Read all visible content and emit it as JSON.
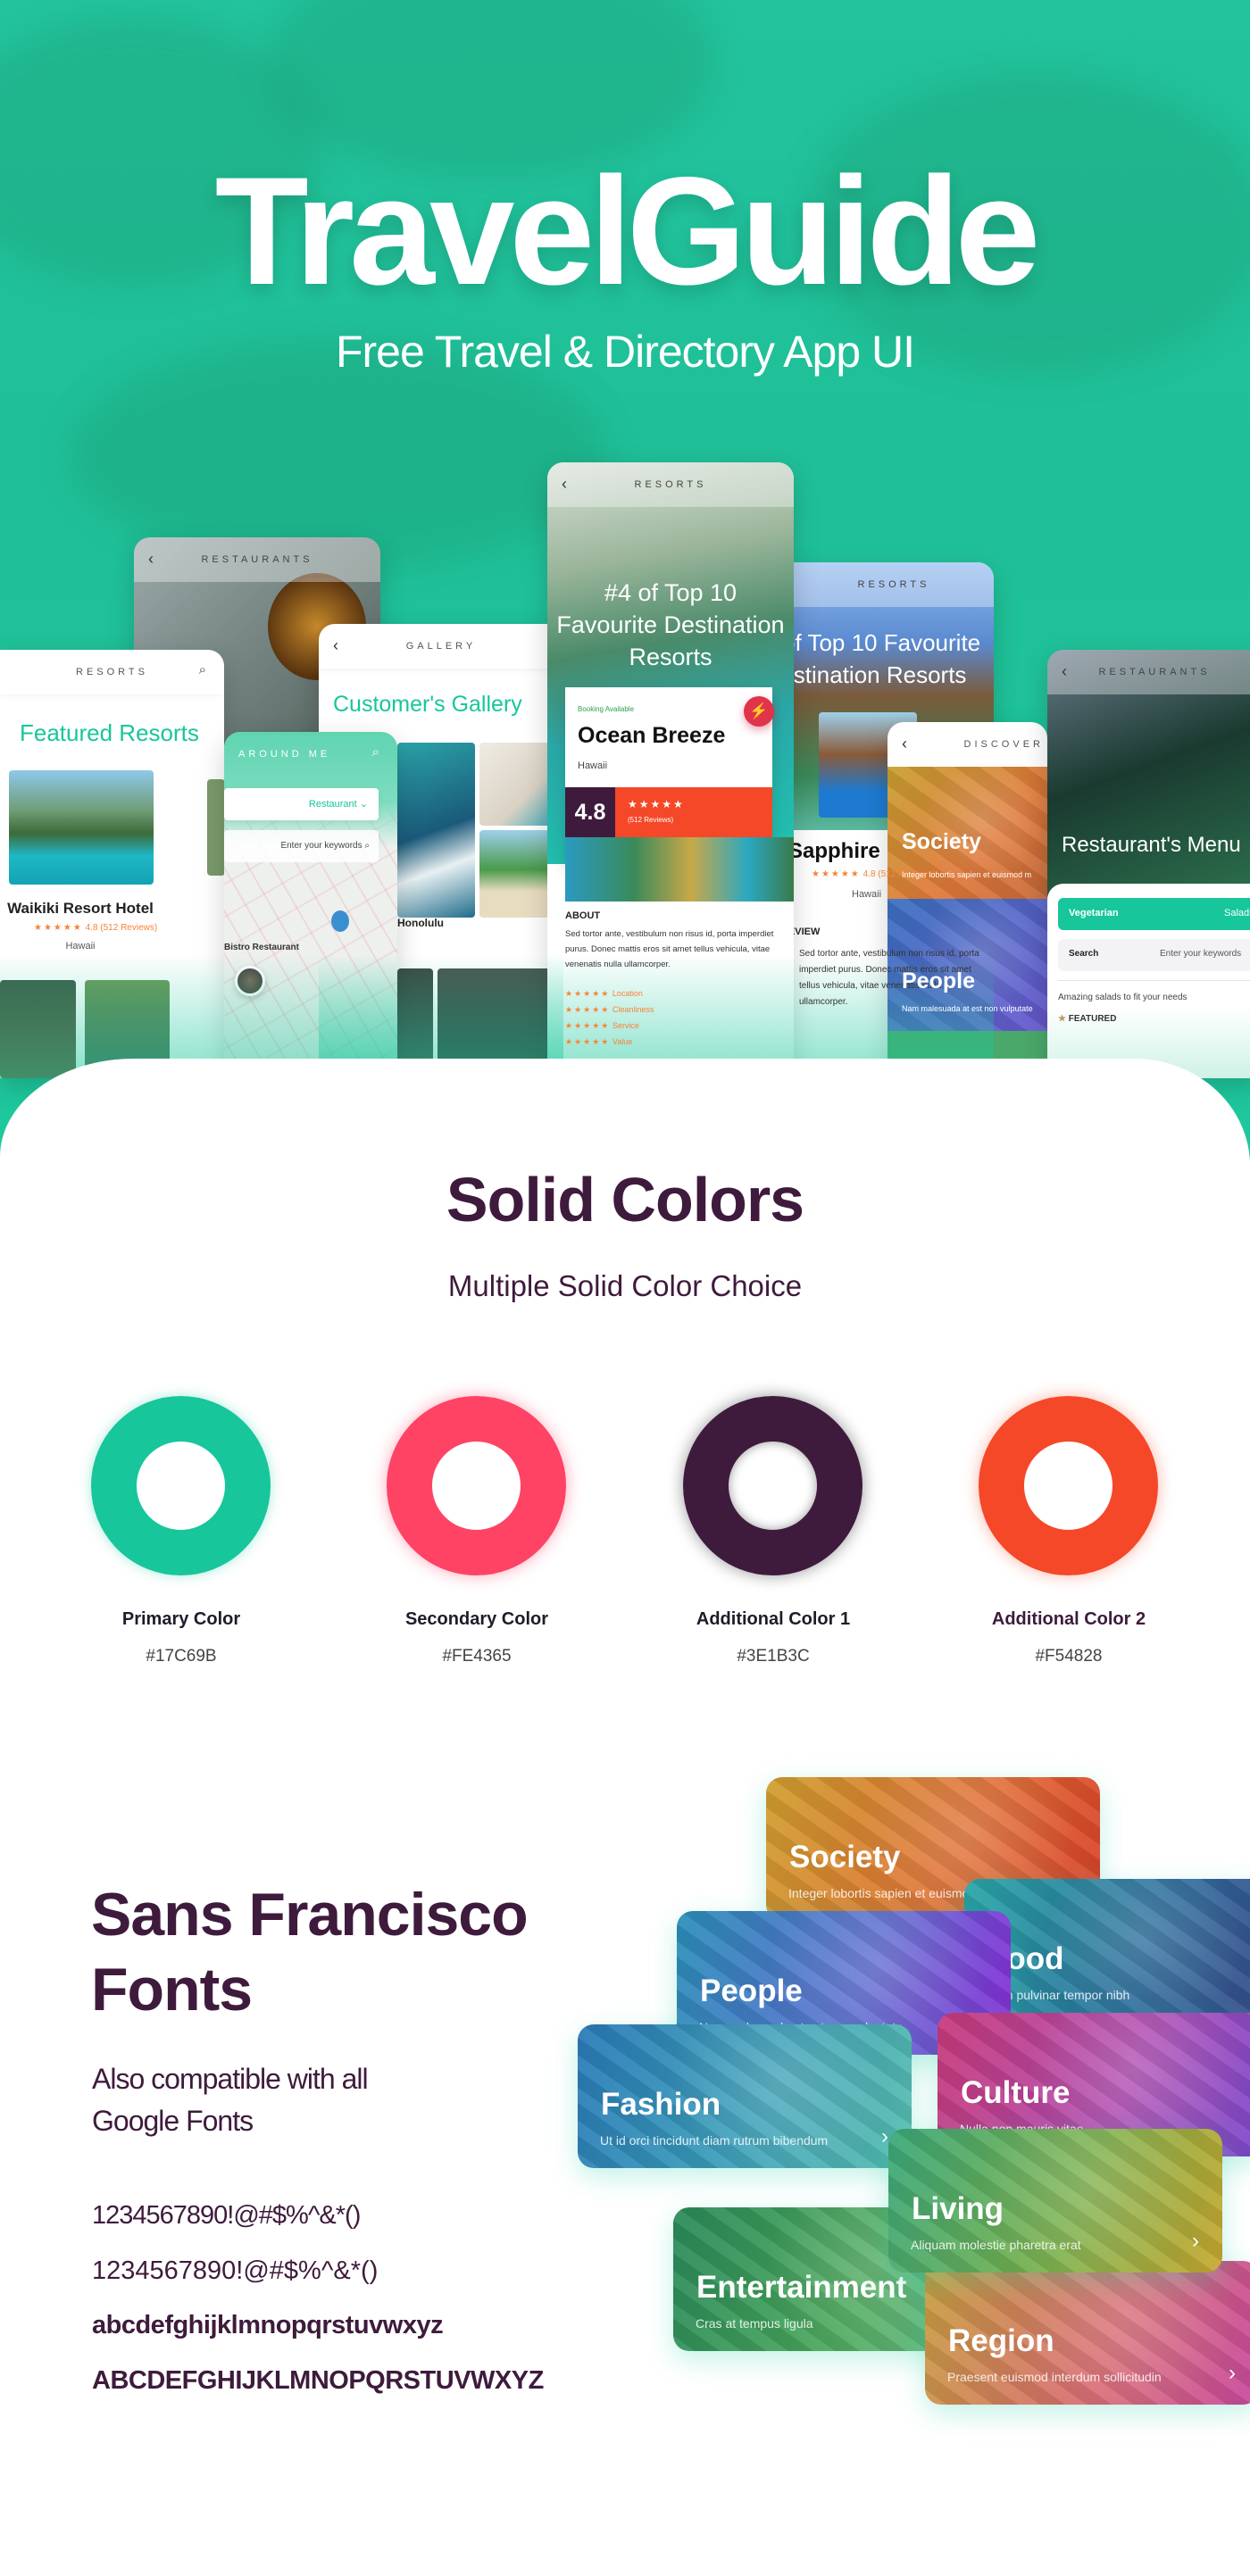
{
  "hero": {
    "title": "TravelGuide",
    "subtitle": "Free Travel & Directory App UI"
  },
  "phones": {
    "resorts_left": {
      "header": "RESORTS",
      "heading": "Featured Resorts",
      "hotel": "Waikiki Resort Hotel",
      "stars": "★★★★★",
      "rating": "4.8 (512 Reviews)",
      "location": "Hawaii"
    },
    "restaurants_back": {
      "header": "RESTAURANTS"
    },
    "gallery": {
      "header": "GALLERY",
      "heading": "Customer's Gallery",
      "caption": "Honolulu"
    },
    "around_me": {
      "header": "AROUND ME",
      "dropdown": "Restaurant",
      "search_placeholder": "Enter your keywords",
      "place": "Bistro Restaurant"
    },
    "resort_detail": {
      "header": "RESORTS",
      "headline": "#4 of Top 10 Favourite Destination Resorts",
      "booking": "Booking Available",
      "name": "Ocean Breeze",
      "location": "Hawaii",
      "score": "4.8",
      "stars": "★★★★★",
      "reviews": "(512 Reviews)",
      "about_title": "ABOUT",
      "about_text": "Sed tortor ante, vestibulum non risus id, porta imperdiet purus. Donec mattis eros sit amet tellus vehicula, vitae venenatis nulla ullamcorper.",
      "criteria": [
        "Location",
        "Cleanliness",
        "Service",
        "Value"
      ]
    },
    "resorts_right": {
      "header": "RESORTS",
      "headline": "#4 of Top 10 Favourite Destination Resorts",
      "name": "Sapphire",
      "stars": "★★★★★",
      "rating": "4.8 (512 Reviews)",
      "location": "Hawaii",
      "review_title": "REVIEW",
      "review_text": "Sed tortor ante, vestibulum non risus id, porta imperdiet purus. Donec mattis eros sit amet tellus vehicula, vitae venenatis nulla ullamcorper."
    },
    "discover": {
      "header": "DISCOVER",
      "items": [
        {
          "title": "Society",
          "text": "Integer lobortis sapien et euismod m"
        },
        {
          "title": "People",
          "text": "Nam malesuada at est non vulputate"
        }
      ]
    },
    "restaurant_menu": {
      "header": "RESTAURANTS",
      "heading": "Restaurant's Menu",
      "tabs": [
        "Vegetarian",
        "Salads"
      ],
      "search_label": "Search",
      "search_placeholder": "Enter your keywords",
      "tagline": "Amazing salads to fit your needs",
      "featured": "FEATURED"
    }
  },
  "colors_section": {
    "title": "Solid Colors",
    "subtitle": "Multiple Solid Color Choice",
    "swatches": [
      {
        "label": "Primary Color",
        "hex": "#17C69B"
      },
      {
        "label": "Secondary Color",
        "hex": "#FE4365"
      },
      {
        "label": "Additional Color 1",
        "hex": "#3E1B3C"
      },
      {
        "label": "Additional Color 2",
        "hex": "#F54828"
      }
    ]
  },
  "fonts_section": {
    "title_line1": "Sans Francisco",
    "title_line2": "Fonts",
    "subtitle_line1": "Also compatible with all",
    "subtitle_line2": "Google Fonts",
    "samples": [
      "1234567890!@#$%^&*()",
      "1234567890!@#$%^&*()",
      "abcdefghijklmnopqrstuvwxyz",
      "ABCDEFGHIJKLMNOPQRSTUVWXYZ"
    ]
  },
  "category_cards": [
    {
      "title": "Society",
      "text": "Integer lobortis sapien et euismod m"
    },
    {
      "title": "Food",
      "text": "Nam pulvinar tempor nibh"
    },
    {
      "title": "People",
      "text": "Nam malesuada at est non vulputate"
    },
    {
      "title": "Culture",
      "text": "Nulla non mauris vitae"
    },
    {
      "title": "Fashion",
      "text": "Ut id orci tincidunt diam rutrum bibendum"
    },
    {
      "title": "Entertainment",
      "text": "Cras at tempus ligula"
    },
    {
      "title": "Region",
      "text": "Praesent euismod interdum sollicitudin"
    },
    {
      "title": "Living",
      "text": "Aliquam molestie pharetra erat"
    }
  ]
}
